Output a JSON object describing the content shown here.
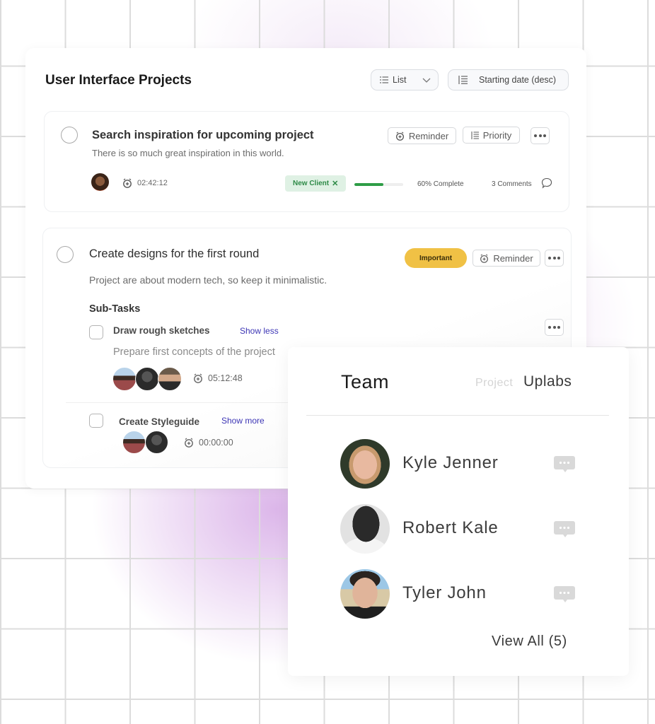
{
  "projects": {
    "title": "User Interface Projects",
    "view_select": {
      "label": "List",
      "icon": "list-icon"
    },
    "sort_select": {
      "label": "Starting date (desc)",
      "icon": "sort-icon"
    },
    "tasks": [
      {
        "title": "Search inspiration for upcoming project",
        "description": "There is so much great inspiration in this world.",
        "actions": {
          "reminder": "Reminder",
          "priority": "Priority"
        },
        "timer": "02:42:12",
        "tag": "New Client",
        "progress_percent": 60,
        "progress_label": "60% Complete",
        "comments": "3 Comments"
      },
      {
        "title": "Create designs for the first round",
        "description": "Project are about modern tech, so keep it  minimalistic.",
        "badge": "Important",
        "actions": {
          "reminder": "Reminder"
        },
        "subtasks_heading": "Sub-Tasks",
        "subtasks": [
          {
            "title": "Draw rough sketches",
            "toggle": "Show less",
            "description": "Prepare first concepts of the project",
            "timer": "05:12:48"
          },
          {
            "title": "Create Styleguide",
            "toggle": "Show more",
            "timer": "00:00:00"
          }
        ]
      }
    ]
  },
  "team": {
    "title": "Team",
    "project_label": "Project",
    "project_name": "Uplabs",
    "members": [
      {
        "name": "Kyle Jenner"
      },
      {
        "name": "Robert Kale"
      },
      {
        "name": "Tyler John"
      }
    ],
    "view_all": "View All (5)"
  },
  "colors": {
    "accent_link": "#3c35b5",
    "progress_green": "#2e9d46",
    "tag_bg": "#dff1e4",
    "important_yellow": "#f0c145"
  }
}
